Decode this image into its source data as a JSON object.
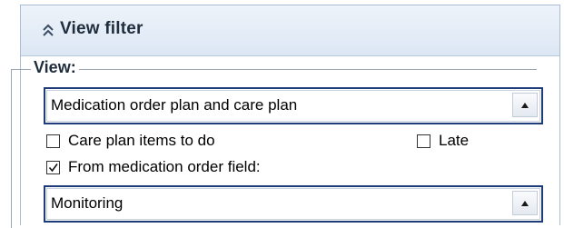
{
  "panel": {
    "title": "View filter",
    "collapse_icon": "double-chevron-up-icon"
  },
  "view_group": {
    "legend": "View:",
    "view_dropdown": {
      "selected": "Medication order plan and care plan",
      "arrow_icon": "dropdown-arrow-icon"
    },
    "checkboxes": [
      {
        "label": "Care plan items to do",
        "checked": false
      },
      {
        "label": "Late",
        "checked": false
      },
      {
        "label": "From medication order field:",
        "checked": true
      }
    ],
    "field_dropdown": {
      "selected": "Monitoring",
      "arrow_icon": "dropdown-arrow-icon"
    }
  },
  "colors": {
    "header_background": "#dce7f4",
    "highlight_border": "#1f3c7a",
    "panel_border": "#a9bdd6"
  }
}
